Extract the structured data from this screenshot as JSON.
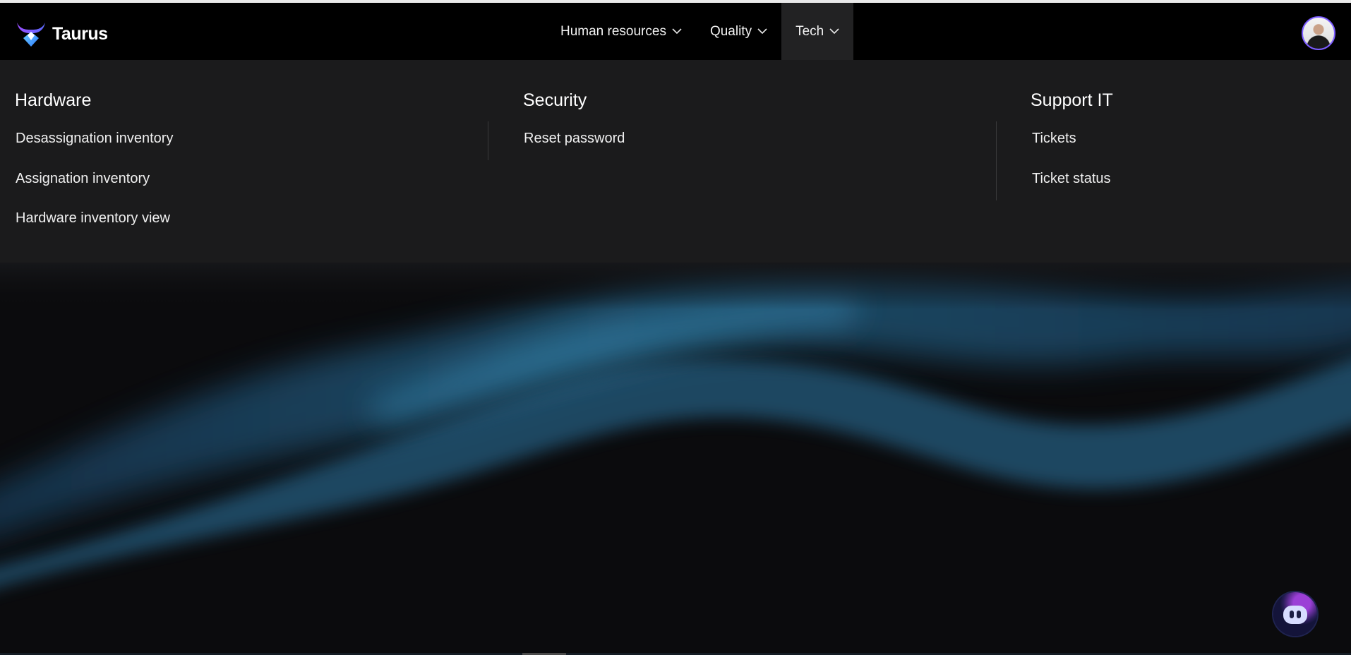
{
  "brand": {
    "name": "Taurus",
    "logo_icon": "taurus-bull-logo-icon",
    "accent_colors": [
      "#7c5cff",
      "#3fb6ff",
      "#b14bff"
    ]
  },
  "nav": {
    "items": [
      {
        "label": "Human resources",
        "icon": "chevron-down-icon",
        "active": false
      },
      {
        "label": "Quality",
        "icon": "chevron-down-icon",
        "active": false
      },
      {
        "label": "Tech",
        "icon": "chevron-down-icon",
        "active": true
      }
    ],
    "user_avatar": "user-avatar"
  },
  "dropdown": {
    "columns": [
      {
        "title": "Hardware",
        "links": [
          "Desassignation inventory",
          "Assignation inventory",
          "Hardware inventory view"
        ]
      },
      {
        "title": "Security",
        "links": [
          "Reset password"
        ]
      },
      {
        "title": "Support IT",
        "links": [
          "Tickets",
          "Ticket status"
        ]
      }
    ]
  },
  "chatbot": {
    "icon": "chatbot-robot-icon"
  },
  "colors": {
    "navbar_bg": "#000000",
    "dropdown_bg": "#1b1b1c",
    "active_tab_bg": "#222223",
    "hero_wave": "#2a6f9a"
  }
}
